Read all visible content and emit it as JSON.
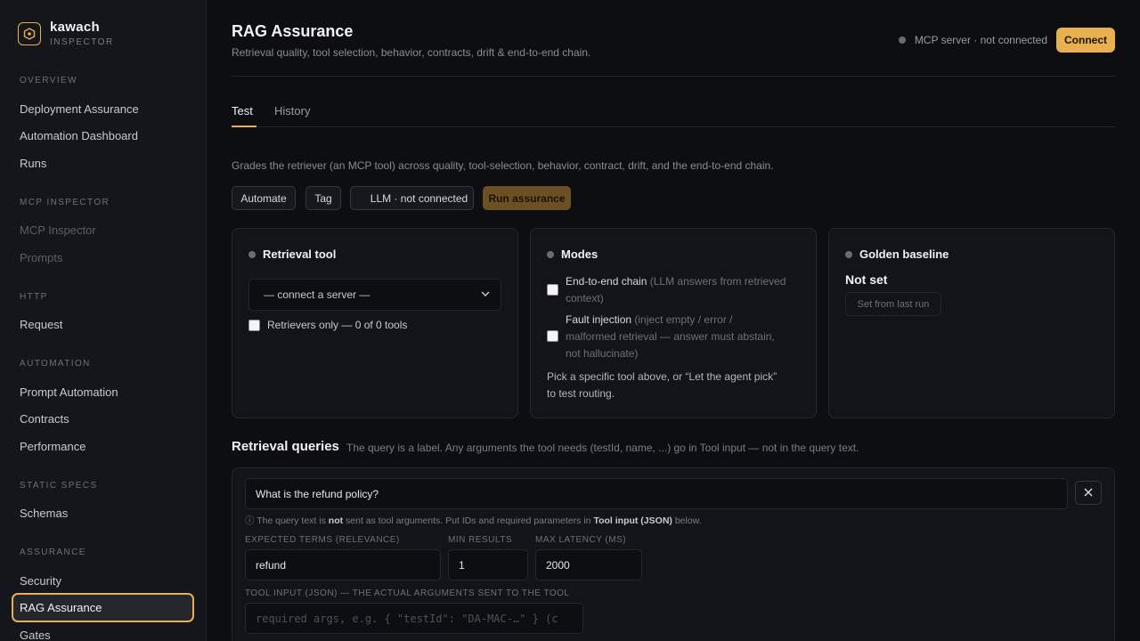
{
  "brand": {
    "name": "kawach",
    "sub": "INSPECTOR",
    "accent": "#e8b04f"
  },
  "sidebar": {
    "sections": [
      {
        "title": "OVERVIEW",
        "items": [
          "Deployment Assurance",
          "Automation Dashboard",
          "Runs"
        ]
      },
      {
        "title": "MCP INSPECTOR",
        "items": [
          "MCP Inspector",
          "Prompts"
        ]
      },
      {
        "title": "HTTP",
        "items": [
          "Request"
        ]
      },
      {
        "title": "AUTOMATION",
        "items": [
          "Prompt Automation",
          "Contracts",
          "Performance"
        ]
      },
      {
        "title": "STATIC SPECS",
        "items": [
          "Schemas"
        ]
      },
      {
        "title": "ASSURANCE",
        "items": [
          "Security",
          "RAG Assurance",
          "Gates"
        ]
      }
    ],
    "active_item": "RAG Assurance"
  },
  "header": {
    "title": "RAG Assurance",
    "subtitle": "Retrieval quality, tool selection, behavior, contracts, drift & end-to-end chain.",
    "server_status": "MCP server · not connected",
    "connect_label": "Connect"
  },
  "tabs": [
    {
      "label": "Test",
      "active": true
    },
    {
      "label": "History",
      "active": false
    }
  ],
  "description": "Grades the retriever (an MCP tool) across quality, tool-selection, behavior, contract, drift, and the end-to-end chain.",
  "actions": {
    "automate": "Automate",
    "tag": "Tag",
    "llm": "LLM · not connected",
    "run": "Run assurance"
  },
  "cards": {
    "retrieval": {
      "title": "Retrieval tool",
      "select_value": "— connect a server —",
      "checkbox_label": "Retrievers only — 0 of 0 tools"
    },
    "modes": {
      "title": "Modes",
      "e2e_label": "End-to-end chain",
      "e2e_hint_a": "(LLM answers from retrieved",
      "e2e_hint_b": "context)",
      "fault_label": "Fault injection",
      "fault_hint_a": "(inject empty / error /",
      "fault_hint_b": "malformed retrieval — answer must abstain,",
      "fault_hint_c": "not hallucinate)",
      "note_a": "Pick a specific tool above, or “Let the agent pick”",
      "note_b": "to test routing."
    },
    "golden": {
      "title": "Golden baseline",
      "status": "Not set",
      "button": "Set from last run"
    }
  },
  "queries": {
    "title": "Retrieval queries",
    "desc": "The query is a label. Any arguments the tool needs (testId, name, ...) go in Tool input — not in the query text.",
    "query_value": "What is the refund policy?",
    "note_prefix": "ⓘ The query text is",
    "note_not": "not",
    "note_mid": "sent as tool arguments. Put IDs and required parameters in",
    "note_tool": "Tool input (JSON)",
    "note_suffix": "below.",
    "expected_label": "EXPECTED TERMS (RELEVANCE)",
    "expected_value": "refund",
    "min_label": "MIN RESULTS",
    "min_value": "1",
    "latency_label": "MAX LATENCY (MS)",
    "latency_value": "2000",
    "tool_input_label": "TOOL INPUT (JSON) — THE ACTUAL ARGUMENTS SENT TO THE TOOL",
    "tool_input_placeholder": "required args, e.g. { \"testId\": \"DA-MAC-…\" }  (c"
  }
}
